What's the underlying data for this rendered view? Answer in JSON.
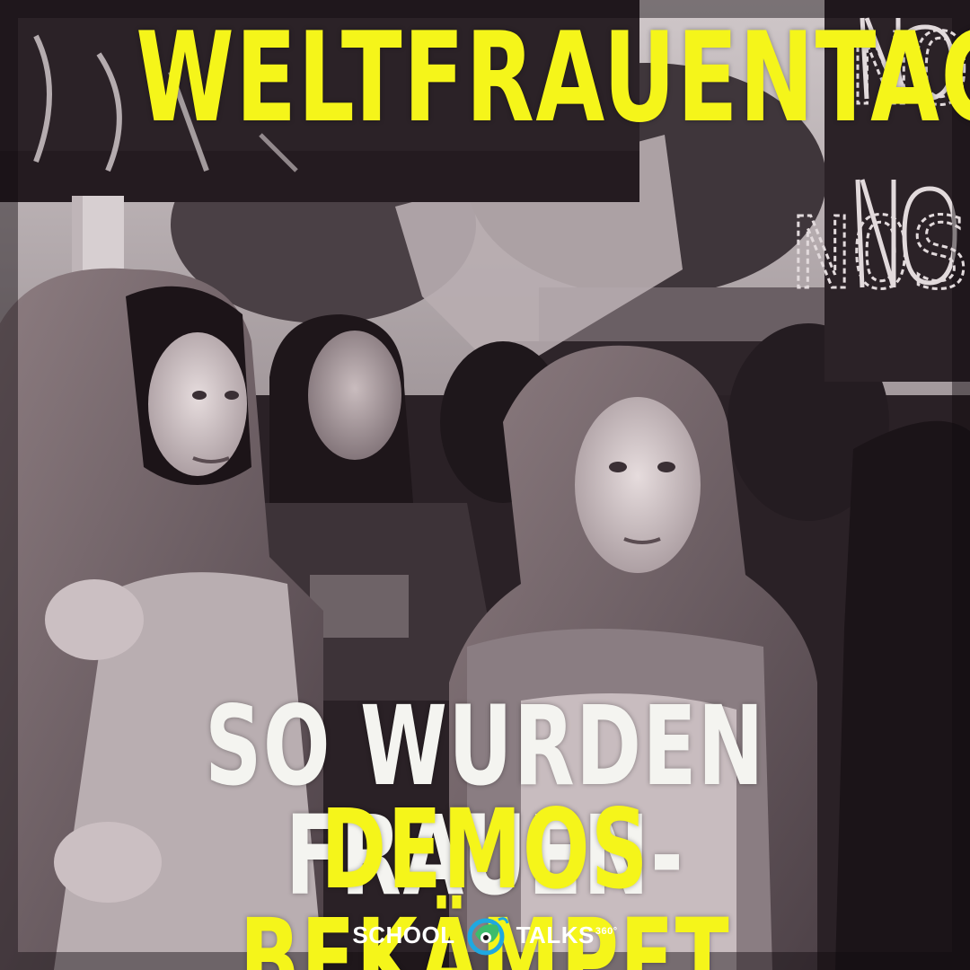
{
  "headline": {
    "title": "WELTFRAUENTAG",
    "line1": "SO WURDEN FRAUEN-",
    "line2": "DEMOS BEKÄMPFT"
  },
  "sign_right": {
    "line1": "NO",
    "line2": "NOS"
  },
  "logo": {
    "left_word": "SCHOOL",
    "right_word": "TALKS",
    "superscript": "360°"
  },
  "colors": {
    "headline_yellow": "#f5f51a",
    "headline_white": "#f4f4f0",
    "logo_blue": "#1fa8e0",
    "logo_green": "#3cbc6c"
  }
}
